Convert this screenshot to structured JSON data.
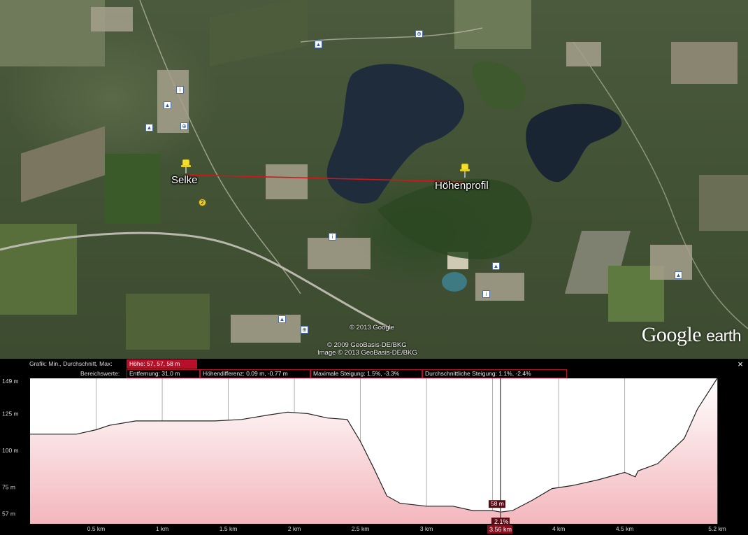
{
  "map": {
    "placemarks": [
      {
        "label": "Selke",
        "icon": "pushpin-icon"
      },
      {
        "label": "Höhenprofil",
        "icon": "pushpin-icon"
      }
    ],
    "marker_number": "2",
    "credits": [
      "© 2013 Google",
      "© 2009 GeoBasis-DE/BKG",
      "Image © 2013 GeoBasis-DE/BKG"
    ],
    "brand": {
      "name": "Google",
      "suffix": "earth"
    },
    "path_color": "#d01818"
  },
  "profile": {
    "graph_label": "Grafik: Min., Durchschnitt, Max:",
    "height_stats": "Höhe: 57, 57, 58 m",
    "range_label": "Bereichswerte:",
    "distance": "Entfernung: 31.0 m",
    "height_diff": "Höhendifferenz: 0.09 m, -0.77 m",
    "max_slope": "Maximale Steigung: 1.5%, -3.3%",
    "avg_slope": "Durchschnittliche Steigung: 1.1%, -2.4%",
    "close_label": "×",
    "cursor": {
      "x_label": "3.56 km",
      "height_label": "58 m",
      "slope_label": "2.1%",
      "x_km": 3.56
    }
  },
  "chart_data": {
    "type": "area",
    "xlabel": "",
    "ylabel": "",
    "y_ticks": [
      {
        "value": 57,
        "label": "57 m"
      },
      {
        "value": 75,
        "label": "75 m"
      },
      {
        "value": 100,
        "label": "100 m"
      },
      {
        "value": 125,
        "label": "125 m"
      },
      {
        "value": 149,
        "label": "149 m"
      }
    ],
    "x_ticks": [
      {
        "value": 0.5,
        "label": "0.5 km"
      },
      {
        "value": 1,
        "label": "1 km"
      },
      {
        "value": 1.5,
        "label": "1.5 km"
      },
      {
        "value": 2,
        "label": "2 km"
      },
      {
        "value": 2.5,
        "label": "2.5 km"
      },
      {
        "value": 3,
        "label": "3 km"
      },
      {
        "value": 3.5,
        "label": ""
      },
      {
        "value": 4,
        "label": "4 km"
      },
      {
        "value": 4.5,
        "label": "4.5 km"
      },
      {
        "value": 5.2,
        "label": "5.2 km"
      }
    ],
    "xlim": [
      0,
      5.2
    ],
    "ylim": [
      50,
      149
    ],
    "x": [
      0,
      0.2,
      0.35,
      0.5,
      0.6,
      0.8,
      1.0,
      1.2,
      1.4,
      1.6,
      1.8,
      1.95,
      2.1,
      2.25,
      2.4,
      2.5,
      2.6,
      2.7,
      2.8,
      3.0,
      3.2,
      3.35,
      3.5,
      3.56,
      3.65,
      3.8,
      3.95,
      4.1,
      4.3,
      4.5,
      4.58,
      4.6,
      4.75,
      4.95,
      5.05,
      5.2
    ],
    "y": [
      111,
      111,
      111,
      114,
      117,
      120,
      120,
      120,
      120,
      121,
      124,
      126,
      125,
      122,
      121,
      106,
      88,
      69,
      64,
      62,
      62,
      59,
      59,
      58,
      59,
      66,
      74,
      76,
      80,
      85,
      82,
      86,
      91,
      108,
      128,
      149
    ],
    "grid": true,
    "fill_color": "#f3b7bd",
    "line_color": "#222222"
  }
}
